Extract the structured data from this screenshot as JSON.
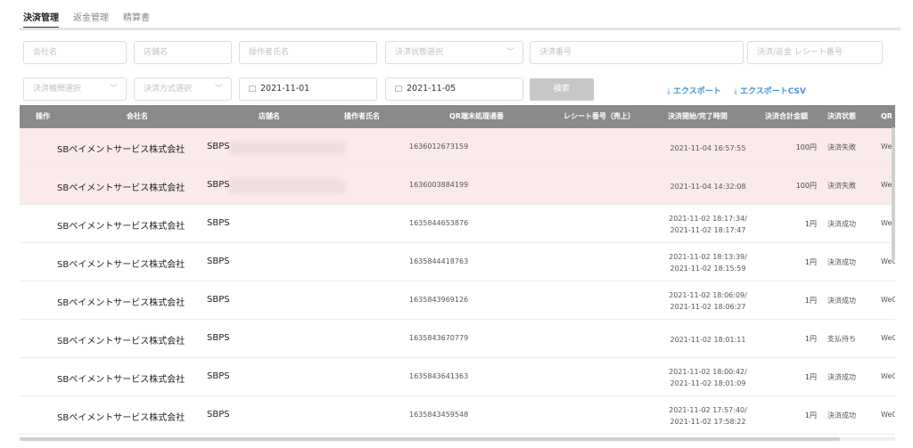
{
  "tabs": [
    {
      "label": "決済管理",
      "active": true
    },
    {
      "label": "返金管理",
      "active": false
    },
    {
      "label": "精算書",
      "active": false
    }
  ],
  "filters": {
    "company_placeholder": "会社名",
    "store_placeholder": "店舗名",
    "operator_placeholder": "操作者氏名",
    "status_placeholder": "決済状態選択",
    "payment_no_placeholder": "決済番号",
    "receipt_placeholder": "決済/返金 レシート番号",
    "device_placeholder": "決済機関選択",
    "method_placeholder": "決済方式選択",
    "date_from": "2021-11-01",
    "date_to": "2021-11-05",
    "search_label": "検索",
    "export_label": "エクスポート",
    "export_csv_label": "エクスポートCSV"
  },
  "columns": {
    "action": "操作",
    "company": "会社名",
    "store": "店舗名",
    "operator": "操作者氏名",
    "qr_no": "QR端末処理通番",
    "receipt": "レシート番号（売上）",
    "datetime": "決済開始/完了時間",
    "amount": "決済合計金額",
    "status": "決済状態",
    "qr_type": "QR"
  },
  "rows": [
    {
      "company": "SBペイメントサービス株式会社",
      "store": "SBPS",
      "qr_no": "1636012673159",
      "time1": "2021-11-04 16:57:55",
      "time2": "",
      "amount": "100円",
      "status": "決済失敗",
      "qr_type": "WeC",
      "failed": true
    },
    {
      "company": "SBペイメントサービス株式会社",
      "store": "SBPS",
      "qr_no": "1636003884199",
      "time1": "2021-11-04 14:32:08",
      "time2": "",
      "amount": "100円",
      "status": "決済失敗",
      "qr_type": "WeC",
      "failed": true
    },
    {
      "company": "SBペイメントサービス株式会社",
      "store": "SBPS",
      "qr_no": "1635844653876",
      "time1": "2021-11-02 18:17:34/",
      "time2": "2021-11-02 18:17:47",
      "amount": "1円",
      "status": "決済成功",
      "qr_type": "WeC",
      "failed": false
    },
    {
      "company": "SBペイメントサービス株式会社",
      "store": "SBPS",
      "qr_no": "1635844418763",
      "time1": "2021-11-02 18:13:39/",
      "time2": "2021-11-02 18:15:59",
      "amount": "1円",
      "status": "決済成功",
      "qr_type": "WeC",
      "failed": false
    },
    {
      "company": "SBペイメントサービス株式会社",
      "store": "SBPS",
      "qr_no": "1635843969126",
      "time1": "2021-11-02 18:06:09/",
      "time2": "2021-11-02 18:06:27",
      "amount": "1円",
      "status": "決済成功",
      "qr_type": "WeC",
      "failed": false
    },
    {
      "company": "SBペイメントサービス株式会社",
      "store": "SBPS",
      "qr_no": "1635843670779",
      "time1": "2021-11-02 18:01:11",
      "time2": "",
      "amount": "1円",
      "status": "支払待ち",
      "qr_type": "WeC",
      "failed": false
    },
    {
      "company": "SBペイメントサービス株式会社",
      "store": "SBPS",
      "qr_no": "1635843641363",
      "time1": "2021-11-02 18:00:42/",
      "time2": "2021-11-02 18:01:09",
      "amount": "1円",
      "status": "決済成功",
      "qr_type": "WeC",
      "failed": false
    },
    {
      "company": "SBペイメントサービス株式会社",
      "store": "SBPS",
      "qr_no": "1635843459548",
      "time1": "2021-11-02 17:57:40/",
      "time2": "2021-11-02 17:58:22",
      "amount": "1円",
      "status": "決済成功",
      "qr_type": "WeC",
      "failed": false
    }
  ],
  "colors": {
    "header_bg": "#8a8a8a",
    "failed_row_bg": "#fbeaea",
    "export_link": "#4a90d9",
    "search_button": "#c7c7c7"
  }
}
